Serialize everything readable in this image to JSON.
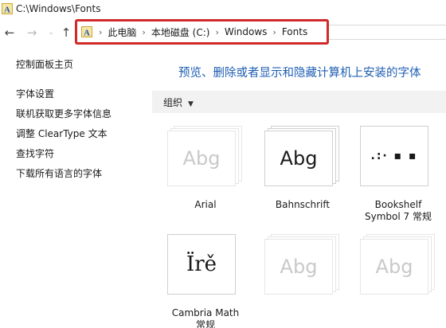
{
  "window": {
    "title": "C:\\Windows\\Fonts"
  },
  "nav": {
    "back_icon": "←",
    "forward_icon": "→",
    "recent_icon": "⌄",
    "up_icon": "↑"
  },
  "address": {
    "separator": "›",
    "crumbs": [
      "此电脑",
      "本地磁盘 (C:)",
      "Windows",
      "Fonts"
    ],
    "highlight_color": "#d02a2a"
  },
  "sidebar": {
    "items": [
      {
        "label": "控制面板主页"
      },
      {
        "label": "字体设置"
      },
      {
        "label": "联机获取更多字体信息"
      },
      {
        "label": "调整 ClearType 文本"
      },
      {
        "label": "查找字符"
      },
      {
        "label": "下载所有语言的字体"
      }
    ]
  },
  "main": {
    "heading": "预览、删除或者显示和隐藏计算机上安装的字体",
    "heading_color": "#1f5fb3",
    "toolbar": {
      "organize_label": "组织",
      "organize_caret": "▼"
    },
    "fonts": [
      {
        "sample": "Abg",
        "name_lines": [
          "Arial"
        ],
        "hidden": true
      },
      {
        "sample": "Abg",
        "name_lines": [
          "Bahnschrift"
        ],
        "hidden": false
      },
      {
        "sample": ".:· ▪ ▪",
        "name_lines": [
          "Bookshelf",
          "Symbol 7 常规"
        ],
        "hidden": false
      },
      {
        "sample": "Ïrě",
        "name_lines": [
          "Cambria Math",
          "常规"
        ],
        "hidden": false
      },
      {
        "sample": "Abg",
        "name_lines": [],
        "hidden": true
      },
      {
        "sample": "Abg",
        "name_lines": [],
        "hidden": true
      }
    ]
  }
}
